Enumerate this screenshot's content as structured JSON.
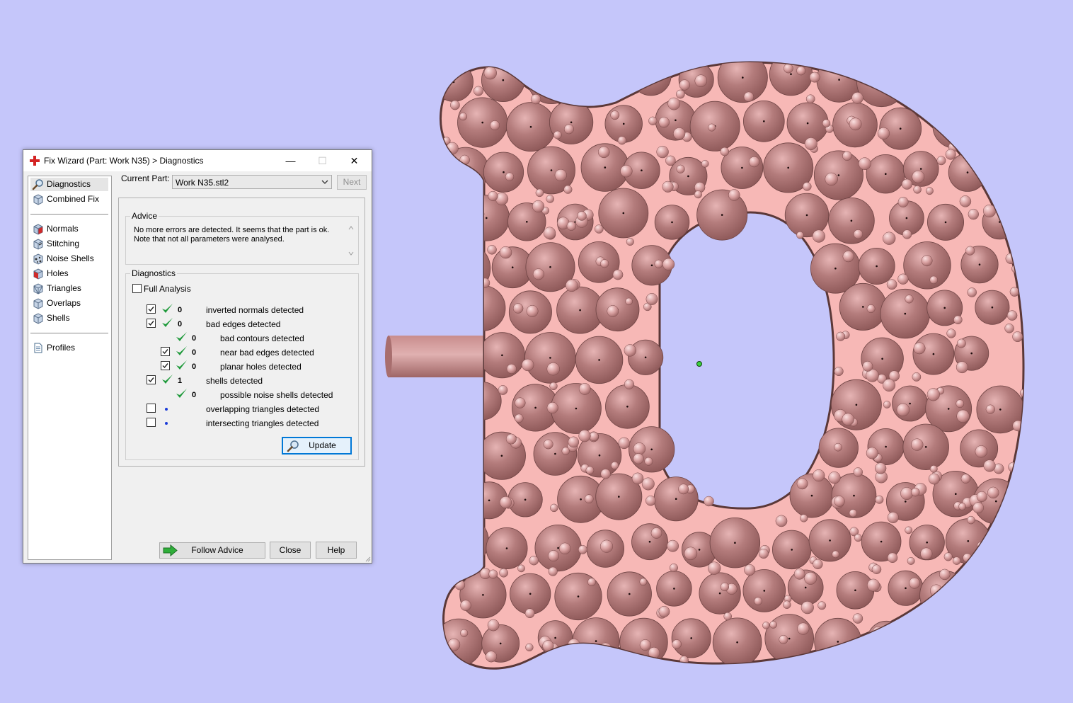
{
  "window": {
    "title": "Fix Wizard (Part: Work N35) > Diagnostics",
    "minimize": "—",
    "maximize": "☐",
    "close": "✕"
  },
  "nav": {
    "items": [
      {
        "label": "Diagnostics",
        "icon": "magnifier-icon",
        "selected": true
      },
      {
        "label": "Combined Fix",
        "icon": "cube-icon"
      },
      {
        "label": "Normals",
        "icon": "normals-cube-icon"
      },
      {
        "label": "Stitching",
        "icon": "stitching-cube-icon"
      },
      {
        "label": "Noise Shells",
        "icon": "noise-shells-icon"
      },
      {
        "label": "Holes",
        "icon": "holes-cube-icon"
      },
      {
        "label": "Triangles",
        "icon": "triangles-cube-icon"
      },
      {
        "label": "Overlaps",
        "icon": "overlaps-cube-icon"
      },
      {
        "label": "Shells",
        "icon": "shells-cube-icon"
      },
      {
        "label": "Profiles",
        "icon": "document-icon"
      }
    ]
  },
  "current_part": {
    "label": "Current Part:",
    "value": "Work N35.stl2",
    "next_label": "Next"
  },
  "advice": {
    "title": "Advice",
    "text_line1": "No more errors are detected. It seems that the part is ok.",
    "text_line2": "Note that not all parameters were analysed."
  },
  "diagnostics": {
    "title": "Diagnostics",
    "full_analysis_label": "Full Analysis",
    "rows": [
      {
        "count": "0",
        "label": "inverted normals detected",
        "checked": true,
        "status": "ok"
      },
      {
        "count": "0",
        "label": "bad edges detected",
        "checked": true,
        "status": "ok"
      },
      {
        "count": "0",
        "label": "bad contours detected",
        "status": "ok"
      },
      {
        "count": "0",
        "label": "near bad edges detected",
        "checked": true,
        "status": "ok"
      },
      {
        "count": "0",
        "label": "planar holes detected",
        "checked": true,
        "status": "ok"
      },
      {
        "count": "1",
        "label": "shells detected",
        "checked": true,
        "status": "ok"
      },
      {
        "count": "0",
        "label": "possible noise shells detected",
        "status": "ok"
      },
      {
        "count": "",
        "label": "overlapping triangles detected",
        "checked": false,
        "status": "none"
      },
      {
        "count": "",
        "label": "intersecting triangles detected",
        "checked": false,
        "status": "none"
      }
    ],
    "update_label": "Update"
  },
  "footer": {
    "follow_advice_label": "Follow Advice",
    "close_label": "Close",
    "help_label": "Help"
  },
  "colors": {
    "background": "#c5c6fa",
    "part_fill": "#f7b8b6",
    "sphere": "#a36a6a",
    "check_green": "#1f9a3b",
    "dot_blue": "#1a3bd8",
    "accent": "#0078d7"
  }
}
